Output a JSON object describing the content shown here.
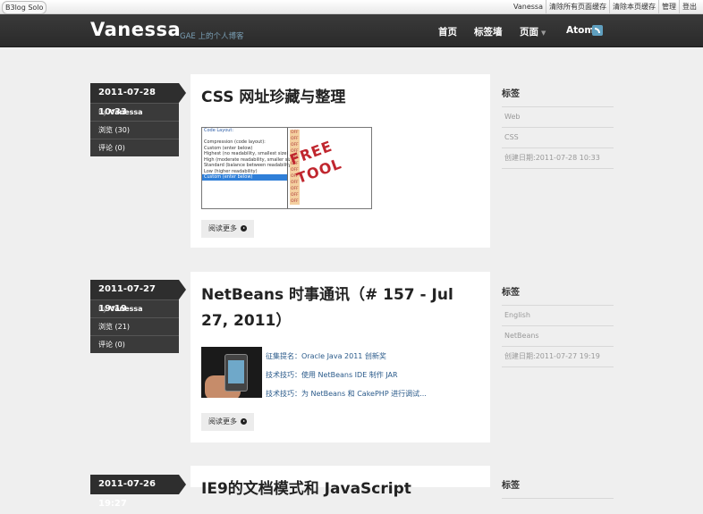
{
  "topbar": {
    "brand": "B3log Solo",
    "links": [
      "Vanessa",
      "清除所有页面缓存",
      "清除本页缓存",
      "管理",
      "登出"
    ]
  },
  "header": {
    "title": "Vanessa",
    "subtitle": "GAE 上的个人博客",
    "nav": {
      "home": "首页",
      "tags": "标签墙",
      "pages": "页面",
      "atom": "Atom"
    }
  },
  "articles": [
    {
      "date": "2011-07-28 10:33",
      "by_label": "by",
      "author": "Vanessa",
      "views": "浏览 (30)",
      "comments": "评论 (0)",
      "title": "CSS 网址珍藏与整理",
      "read_more": "阅读更多",
      "tags_heading": "标签",
      "tags": [
        "Web",
        "CSS"
      ],
      "created": "创建日期:2011-07-28 10:33",
      "thumb_lines": [
        "Code Layout:",
        "",
        "Compression (code layout):",
        "Custom (enter below)",
        "Highest (no readability, smallest size)",
        "High (moderate readability, smaller size)",
        "Standard (balance between readability)",
        "Low (higher readability)",
        "Custom (enter below)"
      ],
      "thumb_stamp": "FREE TOOL"
    },
    {
      "date": "2011-07-27 19:19",
      "by_label": "by",
      "author": "Vanessa",
      "views": "浏览 (21)",
      "comments": "评论 (0)",
      "title": "NetBeans 时事通讯（# 157 - Jul 27, 2011）",
      "links": [
        "征集提名：Oracle Java 2011 创新奖",
        "技术技巧：使用 NetBeans IDE 制作 JAR",
        "技术技巧：为 NetBeans 和 CakePHP 进行调试..."
      ],
      "read_more": "阅读更多",
      "tags_heading": "标签",
      "tags": [
        "English",
        "NetBeans"
      ],
      "created": "创建日期:2011-07-27 19:19"
    },
    {
      "date": "2011-07-26 19:27",
      "title": "IE9的文档模式和 JavaScript",
      "tags_heading": "标签"
    }
  ]
}
